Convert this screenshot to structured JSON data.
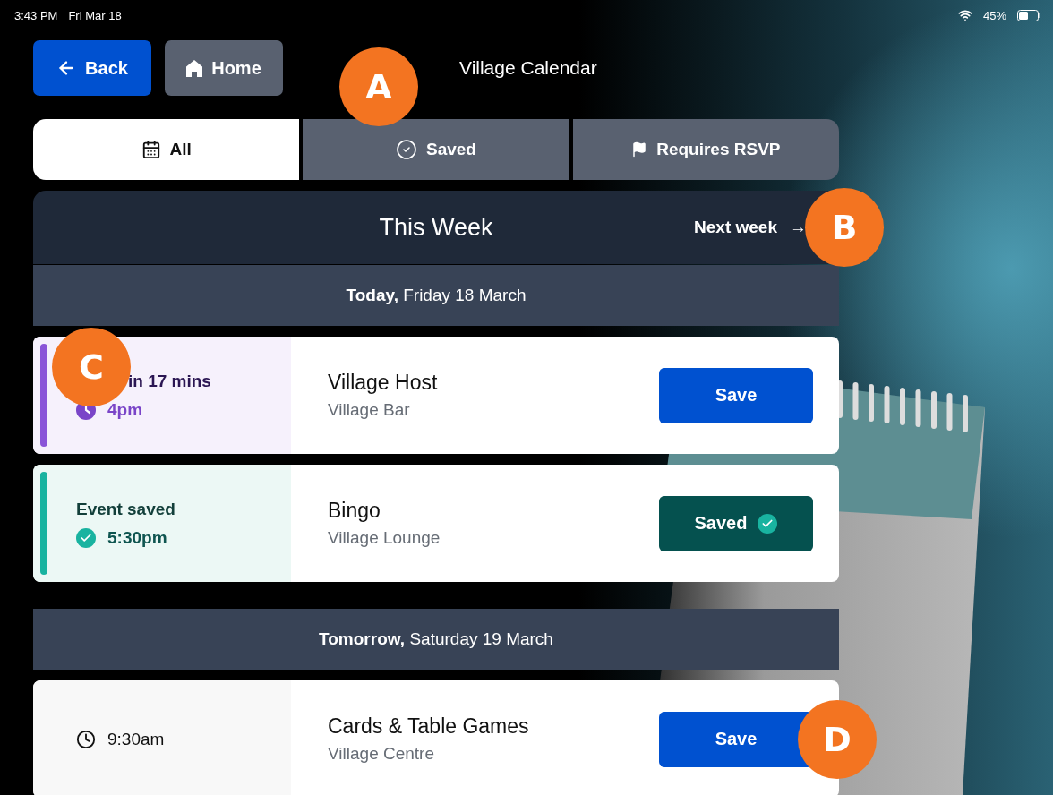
{
  "status_bar": {
    "time": "3:43 PM",
    "date": "Fri Mar 18",
    "battery": "45%"
  },
  "header": {
    "back": "Back",
    "home": "Home",
    "title": "Village Calendar",
    "callout": "A"
  },
  "tabs": [
    {
      "label": "All",
      "kind": "calendar",
      "selected": true
    },
    {
      "label": "Saved",
      "kind": "check",
      "selected": false
    },
    {
      "label": "Requires RSVP",
      "kind": "flag",
      "selected": false
    }
  ],
  "week": {
    "title": "This Week",
    "next": "Next week",
    "arrow": "→",
    "callout": "B"
  },
  "days": [
    {
      "heading": "**Today,** Friday 18 March",
      "events": [
        {
          "kind": "upcoming",
          "status": "in 17 mins",
          "time": "4pm",
          "title": "Village Host",
          "place": "Village Bar",
          "button": "Save",
          "saved": false,
          "callout": "C"
        },
        {
          "kind": "saved",
          "status": "Event saved",
          "time": "5:30pm",
          "title": "Bingo",
          "place": "Village Lounge",
          "button": "Saved",
          "saved": true
        }
      ]
    },
    {
      "heading": "**Tomorrow,** Saturday 19 March",
      "events": [
        {
          "kind": "plain",
          "time": "9:30am",
          "title": "Cards & Table Games",
          "place": "Village Centre",
          "button": "Save",
          "saved": false,
          "callout": "D"
        }
      ]
    }
  ]
}
